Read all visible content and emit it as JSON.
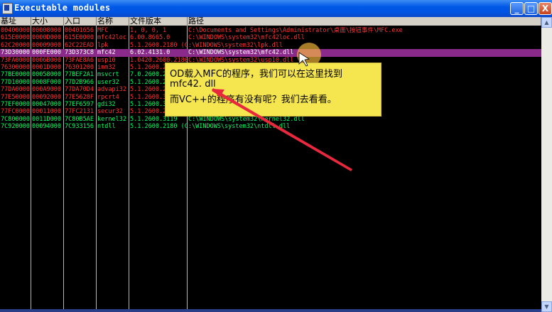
{
  "window": {
    "title": "Executable modules"
  },
  "controls": {
    "minimize": "_",
    "maximize": "□",
    "close": "X"
  },
  "columns": [
    "基址",
    "大小",
    "入口",
    "名称",
    "文件版本",
    "路径"
  ],
  "rows": [
    {
      "base": "00400000",
      "size": "00008000",
      "entry": "00401656",
      "name": "MFC",
      "version": "1, 0, 0, 1",
      "path": "C:\\Documents and Settings\\Administrator\\桌面\\按钮事件\\MFC.exe",
      "color": "#ff3333"
    },
    {
      "base": "615E0000",
      "size": "0000D000",
      "entry": "615E0000",
      "name": "mfc42loc",
      "version": "6.00.8665.0",
      "path": "C:\\WINDOWS\\system32\\mfc42loc.dll",
      "color": "#ff3333"
    },
    {
      "base": "62C20000",
      "size": "00009000",
      "entry": "62C22EAD",
      "name": "lpk",
      "version": "5.1.2600.2180 (C:\\WINDOWS\\system32\\lpk.dll",
      "path": "",
      "color": "#ff3333"
    },
    {
      "base": "73D30000",
      "size": "000FE000",
      "entry": "73D373C8",
      "name": "mfc42",
      "version": "6.02.4131.0",
      "path": "C:\\WINDOWS\\system32\\mfc42.dll",
      "color": "#ffffff"
    },
    {
      "base": "73FA0000",
      "size": "0006B000",
      "entry": "73FAE8A6",
      "name": "usp10",
      "version": "1.0420.2600.2180",
      "path": "C:\\WINDOWS\\system32\\usp10.dll",
      "color": "#ff3333"
    },
    {
      "base": "76300000",
      "size": "0001D000",
      "entry": "76301200",
      "name": "imm32",
      "version": "5.1.2600.2",
      "path": "",
      "color": "#ff3333"
    },
    {
      "base": "77BE0000",
      "size": "00058000",
      "entry": "77BEF2A1",
      "name": "msvcrt",
      "version": "7.0.2600.2",
      "path": "",
      "color": "#00ff66"
    },
    {
      "base": "77D10000",
      "size": "0008F000",
      "entry": "77D2B966",
      "name": "user32",
      "version": "5.1.2600.2",
      "path": "",
      "color": "#00ff66"
    },
    {
      "base": "77DA0000",
      "size": "000A9000",
      "entry": "77DA70D4",
      "name": "advapi32",
      "version": "5.1.2600.2",
      "path": "",
      "color": "#ff3333"
    },
    {
      "base": "77E50000",
      "size": "00092000",
      "entry": "77E5628F",
      "name": "rpcrt4",
      "version": "5.1.2600.3",
      "path": "",
      "color": "#ff3333"
    },
    {
      "base": "77EF0000",
      "size": "00047000",
      "entry": "77EF6597",
      "name": "gdi32",
      "version": "5.1.2600.3",
      "path": "",
      "color": "#00ff66"
    },
    {
      "base": "77FC0000",
      "size": "00011000",
      "entry": "77FC2131",
      "name": "secur32",
      "version": "5.1.2600.2",
      "path": "",
      "color": "#ff3333"
    },
    {
      "base": "7C800000",
      "size": "0011D000",
      "entry": "7C80B5AE",
      "name": "kernel32",
      "version": "5.1.2600.3119",
      "path": "C:\\WINDOWS\\system32\\kernel32.dll",
      "color": "#00ff66"
    },
    {
      "base": "7C920000",
      "size": "00094000",
      "entry": "7C933156",
      "name": "ntdll",
      "version": "5.1.2600.2180 (C:\\WINDOWS\\system32\\ntdll.dll",
      "path": "",
      "color": "#00ff66"
    }
  ],
  "tooltip": {
    "line1": "OD载入MFC的程序，我们可以在这里找到",
    "line2": "mfc42. dll",
    "line3": "而VC++的程序有没有呢？我们去看看。"
  },
  "colors": {
    "selected_row": "#8a2a8a",
    "tooltip_bg": "#f5e650",
    "arrow": "#e8283c"
  }
}
